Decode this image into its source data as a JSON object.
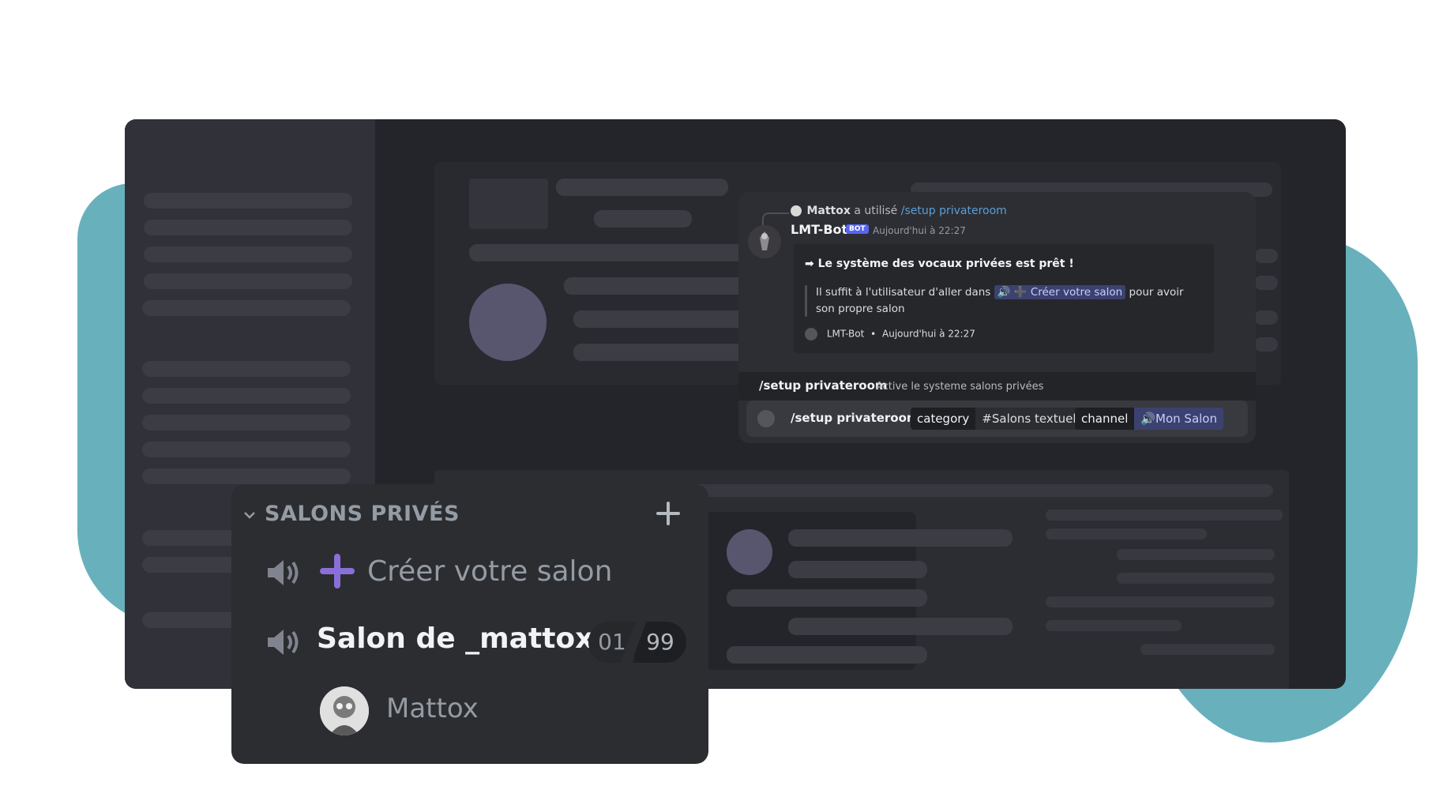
{
  "bot_message": {
    "reply_user": "Mattox",
    "reply_text": "a utilisé",
    "reply_command": "/setup privateroom",
    "bot_name": "LMT-Bot",
    "bot_badge": "BOT",
    "timestamp": "Aujourd'hui à 22:27",
    "embed": {
      "title": "➡ Le système des vocaux privées est prêt !",
      "desc_before": "Il suffit à l'utilisateur d'aller dans",
      "desc_mention": "🔊 ➕ Créer votre salon",
      "desc_after": "pour avoir son propre salon",
      "footer_name": "LMT-Bot",
      "footer_sep": "•",
      "footer_time": "Aujourd'hui à 22:27"
    }
  },
  "command_bar": {
    "name": "/setup privateroom",
    "description": "Active le systeme salons privées"
  },
  "input": {
    "command": "/setup privateroom",
    "options": [
      {
        "key": "category",
        "value": "#Salons textuels"
      },
      {
        "key": "channel",
        "value": "🔊Mon Salon"
      }
    ]
  },
  "channels": {
    "category": "SALONS PRIVÉS",
    "create_channel": "Créer votre salon",
    "room": "Salon de _mattox",
    "user_count": "01",
    "user_limit": "99",
    "member": "Mattox"
  },
  "colors": {
    "blob": "#69b0bd",
    "app_bg": "#24252a",
    "accent_purple": "#8a6fd8",
    "mention": "#3c4270"
  }
}
